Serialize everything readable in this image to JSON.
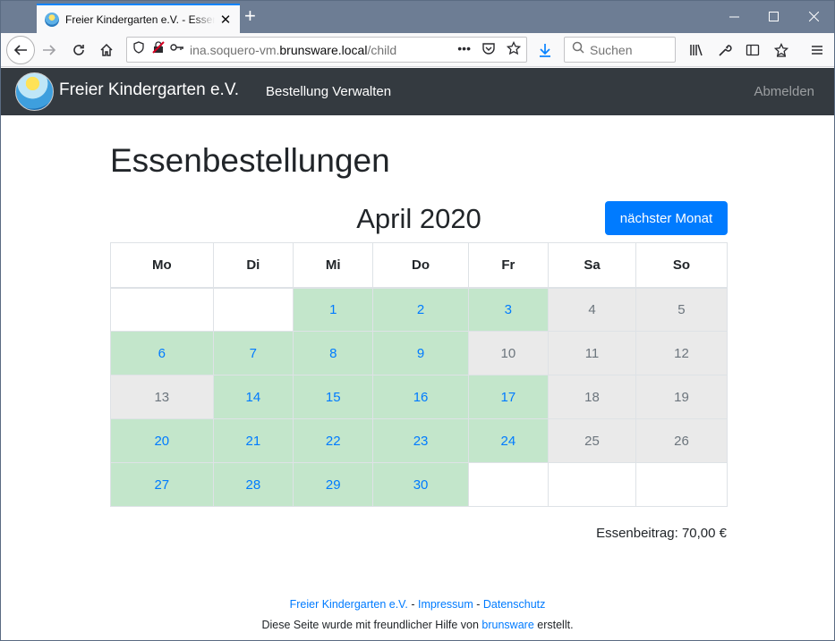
{
  "browser": {
    "tab_title": "Freier Kindergarten e.V. - Essenbestellungen",
    "url_prefix": "ina.soquero-vm.",
    "url_domain": "brunsware.local",
    "url_path": "/child",
    "search_placeholder": "Suchen"
  },
  "nav": {
    "brand": "Freier Kindergarten e.V.",
    "link_orders": "Bestellung Verwalten",
    "logout": "Abmelden"
  },
  "page": {
    "title": "Essenbestellungen",
    "month": "April 2020",
    "next_month_label": "nächster Monat",
    "fee": "Essenbeitrag: 70,00 €"
  },
  "calendar": {
    "weekdays": [
      "Mo",
      "Di",
      "Mi",
      "Do",
      "Fr",
      "Sa",
      "So"
    ],
    "weeks": [
      [
        {
          "d": "",
          "s": "blank"
        },
        {
          "d": "",
          "s": "blank"
        },
        {
          "d": "1",
          "s": "ord"
        },
        {
          "d": "2",
          "s": "ord"
        },
        {
          "d": "3",
          "s": "ord"
        },
        {
          "d": "4",
          "s": "closed"
        },
        {
          "d": "5",
          "s": "closed"
        }
      ],
      [
        {
          "d": "6",
          "s": "ord"
        },
        {
          "d": "7",
          "s": "ord"
        },
        {
          "d": "8",
          "s": "ord"
        },
        {
          "d": "9",
          "s": "ord"
        },
        {
          "d": "10",
          "s": "closed"
        },
        {
          "d": "11",
          "s": "closed"
        },
        {
          "d": "12",
          "s": "closed"
        }
      ],
      [
        {
          "d": "13",
          "s": "closed"
        },
        {
          "d": "14",
          "s": "ord"
        },
        {
          "d": "15",
          "s": "ord"
        },
        {
          "d": "16",
          "s": "ord"
        },
        {
          "d": "17",
          "s": "ord"
        },
        {
          "d": "18",
          "s": "closed"
        },
        {
          "d": "19",
          "s": "closed"
        }
      ],
      [
        {
          "d": "20",
          "s": "ord"
        },
        {
          "d": "21",
          "s": "ord"
        },
        {
          "d": "22",
          "s": "ord"
        },
        {
          "d": "23",
          "s": "ord"
        },
        {
          "d": "24",
          "s": "ord"
        },
        {
          "d": "25",
          "s": "closed"
        },
        {
          "d": "26",
          "s": "closed"
        }
      ],
      [
        {
          "d": "27",
          "s": "ord"
        },
        {
          "d": "28",
          "s": "ord"
        },
        {
          "d": "29",
          "s": "ord"
        },
        {
          "d": "30",
          "s": "ord"
        },
        {
          "d": "",
          "s": "blank"
        },
        {
          "d": "",
          "s": "blank"
        },
        {
          "d": "",
          "s": "blank"
        }
      ]
    ]
  },
  "footer": {
    "org": "Freier Kindergarten e.V.",
    "sep": " - ",
    "imprint": "Impressum",
    "privacy": "Datenschutz",
    "credit_before": "Diese Seite wurde mit freundlicher Hilfe von ",
    "credit_link": "brunsware",
    "credit_after": " erstellt."
  }
}
